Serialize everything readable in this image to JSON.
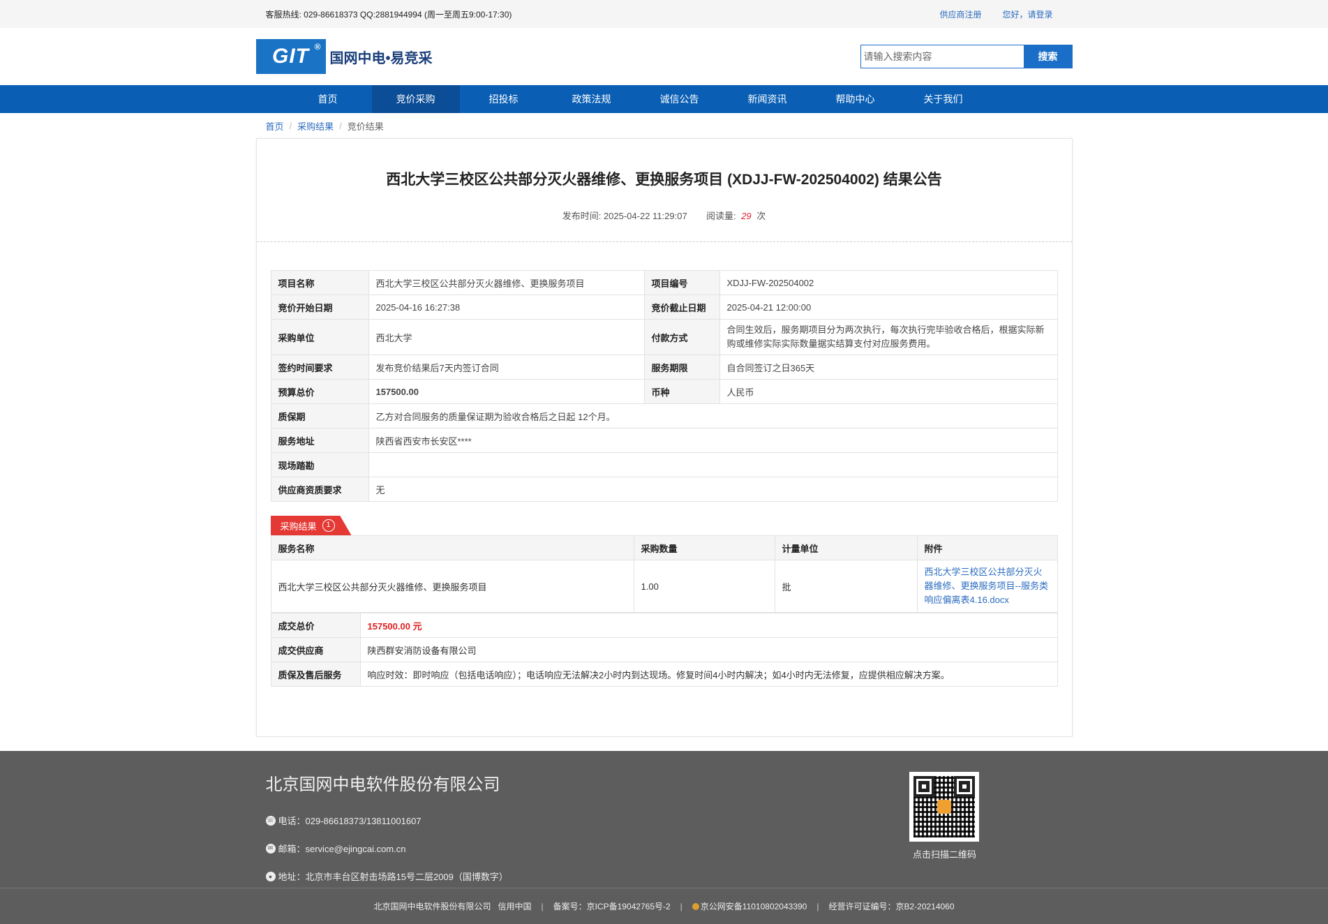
{
  "topbar": {
    "hotline": "客服热线: 029-86618373 QQ:2881944994 (周一至周五9:00-17:30)",
    "supplier_register": "供应商注册",
    "login": "您好，请登录"
  },
  "header": {
    "logo_mark": "GIT",
    "logo_reg": "®",
    "logo_text": "国网中电•易竞采",
    "search_placeholder": "请输入搜索内容",
    "search_button": "搜索"
  },
  "nav": {
    "items": [
      "首页",
      "竞价采购",
      "招投标",
      "政策法规",
      "诚信公告",
      "新闻资讯",
      "帮助中心",
      "关于我们"
    ],
    "active_index": 1
  },
  "breadcrumb": {
    "home": "首页",
    "level2": "采购结果",
    "current": "竞价结果",
    "separator": "/"
  },
  "article": {
    "title": "西北大学三校区公共部分灭火器维修、更换服务项目 (XDJJ-FW-202504002) 结果公告",
    "publish_label": "发布时间:",
    "publish_time": "2025-04-22 11:29:07",
    "views_label": "阅读量:",
    "views": "29",
    "views_unit": "次"
  },
  "info": {
    "project_name_label": "项目名称",
    "project_name": "西北大学三校区公共部分灭火器维修、更换服务项目",
    "project_no_label": "项目编号",
    "project_no": "XDJJ-FW-202504002",
    "start_label": "竞价开始日期",
    "start": "2025-04-16 16:27:38",
    "end_label": "竞价截止日期",
    "end": "2025-04-21 12:00:00",
    "buyer_label": "采购单位",
    "buyer": "西北大学",
    "payment_label": "付款方式",
    "payment": "合同生效后，服务期项目分为两次执行，每次执行完毕验收合格后，根据实际新购或维修实际实际数量据实结算支付对应服务费用。",
    "sign_label": "签约时间要求",
    "sign": "发布竞价结果后7天内签订合同",
    "period_label": "服务期限",
    "period": "自合同签订之日365天",
    "budget_label": "预算总价",
    "budget": "157500.00",
    "currency_label": "币种",
    "currency": "人民币",
    "warranty_label": "质保期",
    "warranty": "乙方对合同服务的质量保证期为验收合格后之日起 12个月。",
    "address_label": "服务地址",
    "address": "陕西省西安市长安区****",
    "site_label": "现场踏勘",
    "site": "",
    "qualification_label": "供应商资质要求",
    "qualification": "无"
  },
  "result": {
    "tag": "采购结果",
    "tag_number": "1",
    "headers": [
      "服务名称",
      "采购数量",
      "计量单位",
      "附件"
    ],
    "row": {
      "name": "西北大学三校区公共部分灭火器维修、更换服务项目",
      "quantity": "1.00",
      "unit": "批",
      "attachment": "西北大学三校区公共部分灭火器维修、更换服务项目--服务类响应偏离表4.16.docx"
    },
    "total_label": "成交总价",
    "total": "157500.00 元",
    "supplier_label": "成交供应商",
    "supplier": "陕西群安消防设备有限公司",
    "aftersale_label": "质保及售后服务",
    "aftersale": "响应时效：即时响应（包括电话响应）；电话响应无法解决2小时内到达现场。修复时间4小时内解决；如4小时内无法修复，应提供相应解决方案。"
  },
  "footer": {
    "company": "北京国网中电软件股份有限公司",
    "phone": "电话：029-86618373/13811001607",
    "email": "邮箱：service@ejingcai.com.cn",
    "address": "地址：北京市丰台区射击场路15号二层2009（国博数字）",
    "qr_caption": "点击扫描二维码",
    "bottom_company": "北京国网中电软件股份有限公司",
    "credit": "信用中国",
    "icp": "备案号：京ICP备19042765号-2",
    "police": "京公网安备11010802043390",
    "license": "经营许可证编号：京B2-20214060",
    "divider": "|"
  },
  "colors": {
    "nav_bg": "#0a5fb5",
    "nav_active": "#0b4d96",
    "accent_red": "#e02020",
    "link_blue": "#2a6bbf",
    "footer_bg": "#5d5d5d"
  }
}
